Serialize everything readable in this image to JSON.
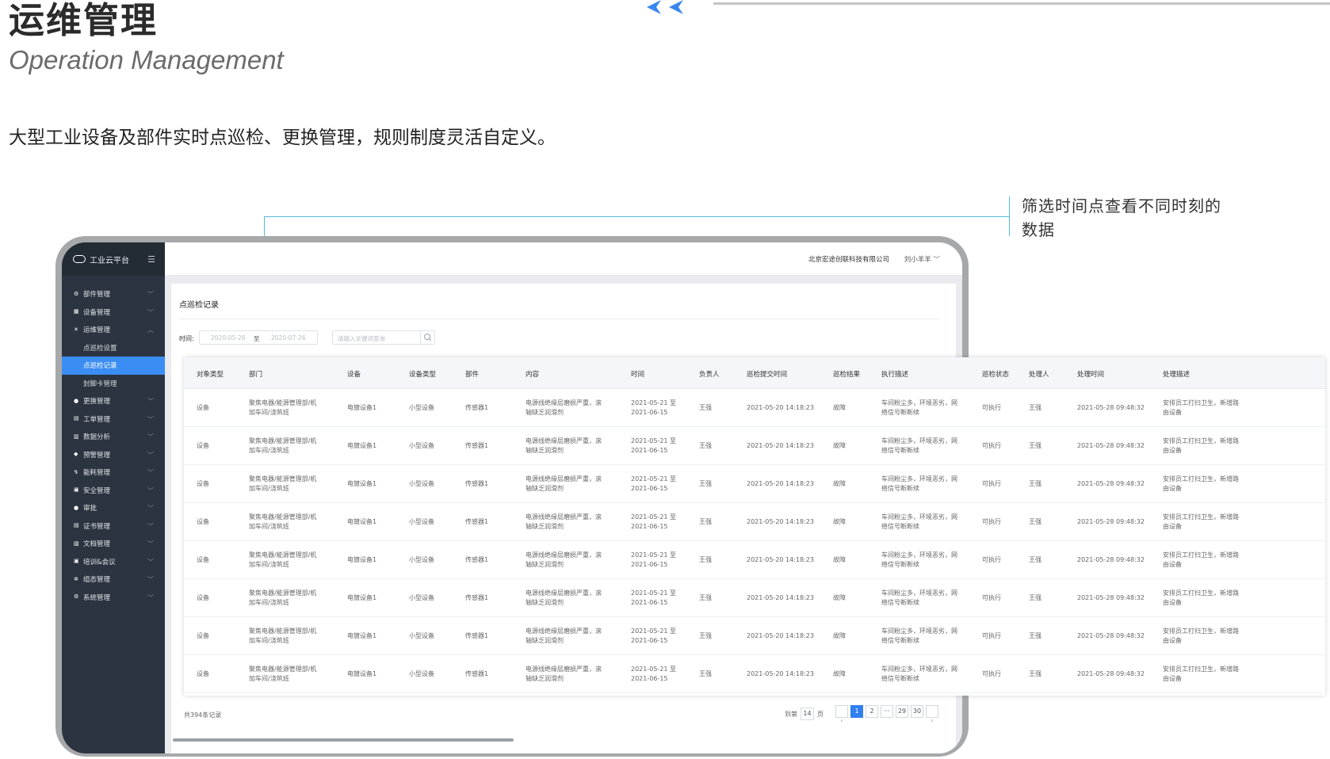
{
  "header": {
    "title": "运维管理",
    "subtitle": "Operation Management",
    "description": "大型工业设备及部件实时点巡检、更换管理，规则制度灵活自定义。",
    "accent_color": "#3a86f0"
  },
  "callout": {
    "text": "筛选时间点查看不同时刻的数据"
  },
  "app": {
    "logo": "工业云平台",
    "company": "北京宏途创联科技有限公司",
    "user": "刘小羊羊 ﹀",
    "menu_toggle_icon": "☰"
  },
  "sidebar": {
    "items": [
      {
        "label": "部件管理",
        "icon": "gear-icon",
        "glyph": "⚙"
      },
      {
        "label": "设备管理",
        "icon": "grid-icon",
        "glyph": "▦"
      },
      {
        "label": "运维管理",
        "icon": "tools-icon",
        "glyph": "✕",
        "expanded": true
      },
      {
        "label": "点巡检设置",
        "sub": true
      },
      {
        "label": "点巡检记录",
        "sub": true,
        "active": true
      },
      {
        "label": "封脚卡管理",
        "sub": true
      },
      {
        "label": "更换管理",
        "icon": "swap-icon",
        "glyph": "●"
      },
      {
        "label": "工单管理",
        "icon": "document-icon",
        "glyph": "▤"
      },
      {
        "label": "数据分析",
        "icon": "chart-icon",
        "glyph": "▥"
      },
      {
        "label": "预警管理",
        "icon": "warning-icon",
        "glyph": "◆"
      },
      {
        "label": "能耗管理",
        "icon": "energy-icon",
        "glyph": "↯"
      },
      {
        "label": "安全管理",
        "icon": "lock-icon",
        "glyph": "▣"
      },
      {
        "label": "审批",
        "icon": "person-icon",
        "glyph": "●"
      },
      {
        "label": "证书管理",
        "icon": "certificate-icon",
        "glyph": "▤"
      },
      {
        "label": "文档管理",
        "icon": "folder-icon",
        "glyph": "▧"
      },
      {
        "label": "培训&会议",
        "icon": "meeting-icon",
        "glyph": "▣"
      },
      {
        "label": "组态管理",
        "icon": "network-icon",
        "glyph": "✲"
      },
      {
        "label": "系统管理",
        "icon": "settings-icon",
        "glyph": "⚙"
      }
    ]
  },
  "panel": {
    "title": "点巡检记录",
    "filter_label": "时间:",
    "date_start": "2020-05-26",
    "date_sep": "至",
    "date_end": "2020-07-26",
    "search_placeholder": "请输入关键词查询"
  },
  "table": {
    "columns": [
      "对象类型",
      "部门",
      "设备",
      "设备类型",
      "部件",
      "内容",
      "时间",
      "负责人",
      "巡检提交时间",
      "巡检结果",
      "执行描述",
      "巡检状态",
      "处理人",
      "处理时间",
      "处理描述"
    ],
    "rows": [
      [
        "设备",
        "聚焦电器/能源管理部/机|加车间/浇筑班",
        "电镀设备1",
        "小型设备",
        "传感器1",
        "电源线绝缘层磨损严重，滚|轴缺乏润滑剂",
        "2021-05-21 至|2021-06-15",
        "王强",
        "2021-05-20 14:18:23",
        "故障",
        "车间粉尘多，环境恶劣，网|络信号断断续",
        "可执行",
        "王强",
        "2021-05-28 09:48:32",
        "安排员工打扫卫生，新增路|由设备"
      ],
      [
        "设备",
        "聚焦电器/能源管理部/机|加车间/浇筑班",
        "电镀设备1",
        "小型设备",
        "传感器1",
        "电源线绝缘层磨损严重，滚|轴缺乏润滑剂",
        "2021-05-21 至|2021-06-15",
        "王强",
        "2021-05-20 14:18:23",
        "故障",
        "车间粉尘多，环境恶劣，网|络信号断断续",
        "可执行",
        "王强",
        "2021-05-28 09:48:32",
        "安排员工打扫卫生，新增路|由设备"
      ],
      [
        "设备",
        "聚焦电器/能源管理部/机|加车间/浇筑班",
        "电镀设备1",
        "小型设备",
        "传感器1",
        "电源线绝缘层磨损严重，滚|轴缺乏润滑剂",
        "2021-05-21 至|2021-06-15",
        "王强",
        "2021-05-20 14:18:23",
        "故障",
        "车间粉尘多，环境恶劣，网|络信号断断续",
        "可执行",
        "王强",
        "2021-05-28 09:48:32",
        "安排员工打扫卫生，新增路|由设备"
      ],
      [
        "设备",
        "聚焦电器/能源管理部/机|加车间/浇筑班",
        "电镀设备1",
        "小型设备",
        "传感器1",
        "电源线绝缘层磨损严重，滚|轴缺乏润滑剂",
        "2021-05-21 至|2021-06-15",
        "王强",
        "2021-05-20 14:18:23",
        "故障",
        "车间粉尘多，环境恶劣，网|络信号断断续",
        "可执行",
        "王强",
        "2021-05-28 09:48:32",
        "安排员工打扫卫生，新增路|由设备"
      ],
      [
        "设备",
        "聚焦电器/能源管理部/机|加车间/浇筑班",
        "电镀设备1",
        "小型设备",
        "传感器1",
        "电源线绝缘层磨损严重，滚|轴缺乏润滑剂",
        "2021-05-21 至|2021-06-15",
        "王强",
        "2021-05-20 14:18:23",
        "故障",
        "车间粉尘多，环境恶劣，网|络信号断断续",
        "可执行",
        "王强",
        "2021-05-28 09:48:32",
        "安排员工打扫卫生，新增路|由设备"
      ],
      [
        "设备",
        "聚焦电器/能源管理部/机|加车间/浇筑班",
        "电镀设备1",
        "小型设备",
        "传感器1",
        "电源线绝缘层磨损严重，滚|轴缺乏润滑剂",
        "2021-05-21 至|2021-06-15",
        "王强",
        "2021-05-20 14:18:23",
        "故障",
        "车间粉尘多，环境恶劣，网|络信号断断续",
        "可执行",
        "王强",
        "2021-05-28 09:48:32",
        "安排员工打扫卫生，新增路|由设备"
      ],
      [
        "设备",
        "聚焦电器/能源管理部/机|加车间/浇筑班",
        "电镀设备1",
        "小型设备",
        "传感器1",
        "电源线绝缘层磨损严重，滚|轴缺乏润滑剂",
        "2021-05-21 至|2021-06-15",
        "王强",
        "2021-05-20 14:18:23",
        "故障",
        "车间粉尘多，环境恶劣，网|络信号断断续",
        "可执行",
        "王强",
        "2021-05-28 09:48:32",
        "安排员工打扫卫生，新增路|由设备"
      ],
      [
        "设备",
        "聚焦电器/能源管理部/机|加车间/浇筑班",
        "电镀设备1",
        "小型设备",
        "传感器1",
        "电源线绝缘层磨损严重，滚|轴缺乏润滑剂",
        "2021-05-21 至|2021-06-15",
        "王强",
        "2021-05-20 14:18:23",
        "故障",
        "车间粉尘多，环境恶劣，网|络信号断断续",
        "可执行",
        "王强",
        "2021-05-28 09:48:32",
        "安排员工打扫卫生，新增路|由设备"
      ]
    ]
  },
  "footer": {
    "total": "共394条记录",
    "goto_prefix": "到第",
    "goto_value": "14",
    "goto_suffix": "页",
    "pages": [
      "‹",
      "1",
      "2",
      "···",
      "29",
      "30",
      "›"
    ],
    "current_page": "1"
  }
}
